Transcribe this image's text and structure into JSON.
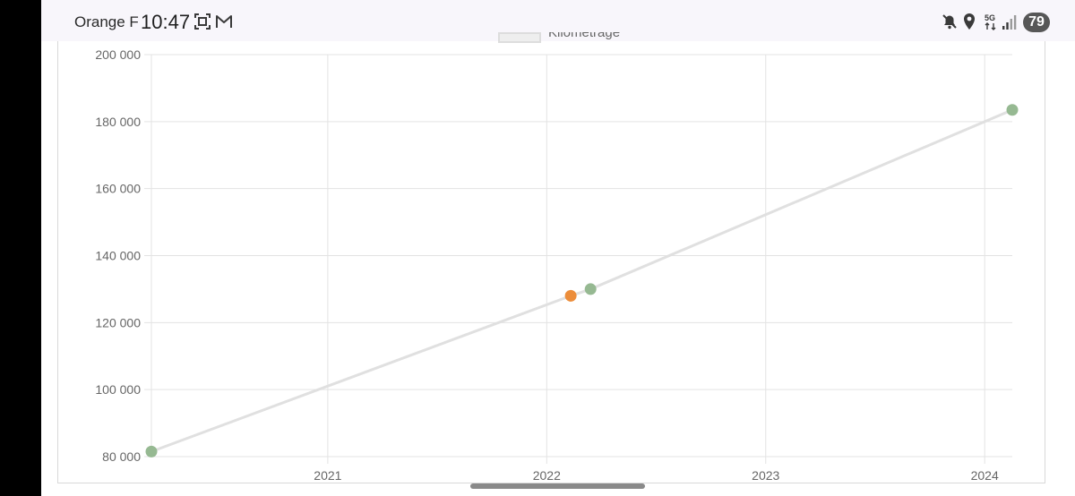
{
  "status_bar": {
    "carrier": "Orange F",
    "time": "10:47",
    "battery": "79",
    "icons": [
      "screenshot-icon",
      "gmail-icon",
      "mute-icon",
      "location-icon",
      "5g-icon",
      "signal-icon"
    ]
  },
  "chart_data": {
    "type": "line",
    "legend": {
      "label": "Kilométrage",
      "placement": "top"
    },
    "x_ticks": [
      "2021",
      "2022",
      "2023",
      "2024"
    ],
    "y_ticks": [
      "80 000",
      "100 000",
      "120 000",
      "140 000",
      "160 000",
      "180 000",
      "200 000"
    ],
    "ylim": [
      80000,
      200000
    ],
    "xlim": [
      "2020-03-13",
      "2024-02-16"
    ],
    "grid": true,
    "series": [
      {
        "name": "Kilométrage",
        "color": "#e0e0e0",
        "points": [
          {
            "date": "2020-03-13",
            "value": 81500,
            "color": "#96b992"
          },
          {
            "date": "2022-02-10",
            "value": 128000,
            "color": "#ec8d3a"
          },
          {
            "date": "2022-03-15",
            "value": 130000,
            "color": "#96b992"
          },
          {
            "date": "2024-02-16",
            "value": 183500,
            "color": "#96b992"
          }
        ]
      }
    ]
  }
}
